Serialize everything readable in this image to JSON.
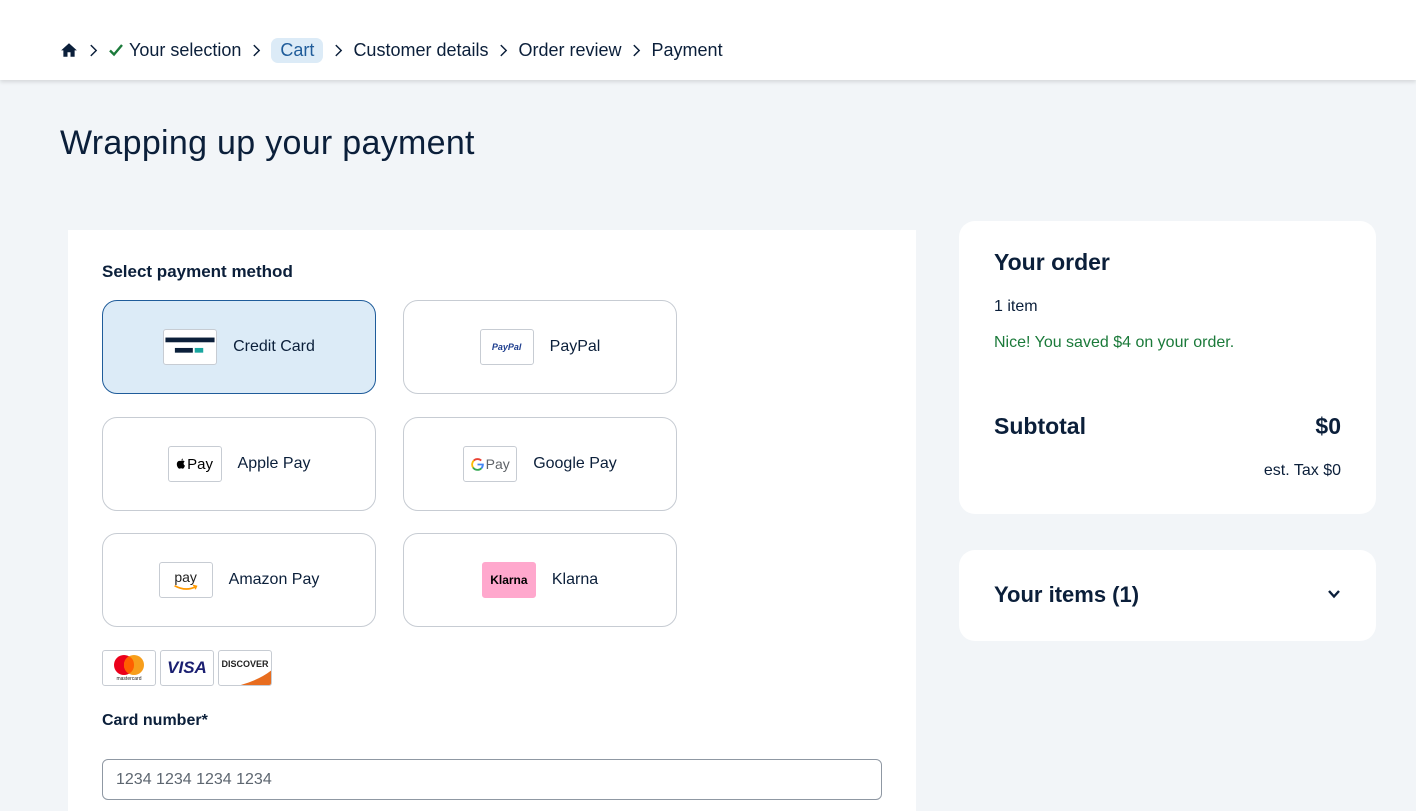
{
  "breadcrumb": {
    "home_icon": "home-icon",
    "items": [
      "Your selection",
      "Cart",
      "Customer details",
      "Order review",
      "Payment"
    ],
    "completed_icon": "check-icon",
    "separator_icon": "chevron-right-icon"
  },
  "page": {
    "title": "Wrapping up your payment"
  },
  "payment": {
    "section_label": "Select payment method",
    "selected": "Credit Card",
    "methods": [
      {
        "label": "Credit Card",
        "icon": "credit-card-icon"
      },
      {
        "label": "PayPal",
        "icon": "paypal-logo",
        "logo_text": "PayPal"
      },
      {
        "label": "Apple Pay",
        "icon": "apple-pay-logo",
        "logo_text": "Pay"
      },
      {
        "label": "Google Pay",
        "icon": "google-pay-logo",
        "logo_text": "Pay"
      },
      {
        "label": "Amazon Pay",
        "icon": "amazon-pay-logo",
        "logo_text": "pay"
      },
      {
        "label": "Klarna",
        "icon": "klarna-logo",
        "logo_text": "Klarna"
      }
    ],
    "card_brands": [
      {
        "name": "mastercard",
        "text": "mastercard"
      },
      {
        "name": "visa",
        "text": "VISA"
      },
      {
        "name": "discover",
        "text": "DISCOVER"
      }
    ],
    "card_number_label": "Card number*",
    "card_number_placeholder": "1234 1234 1234 1234",
    "card_number_value": ""
  },
  "order": {
    "title": "Your order",
    "item_count": "1 item",
    "savings": "Nice! You saved $4 on your order.",
    "subtotal_label": "Subtotal",
    "subtotal_value": "$0",
    "tax": "est. Tax $0"
  },
  "items": {
    "title": "Your items (1)",
    "toggle_icon": "chevron-down-icon"
  },
  "colors": {
    "accent": "#1f5c9a",
    "selected_bg": "#dcebf7",
    "success": "#1b7a3a",
    "text": "#0b1f3a",
    "page_bg": "#f2f5f8",
    "klarna_pink": "#ffa8cd"
  }
}
